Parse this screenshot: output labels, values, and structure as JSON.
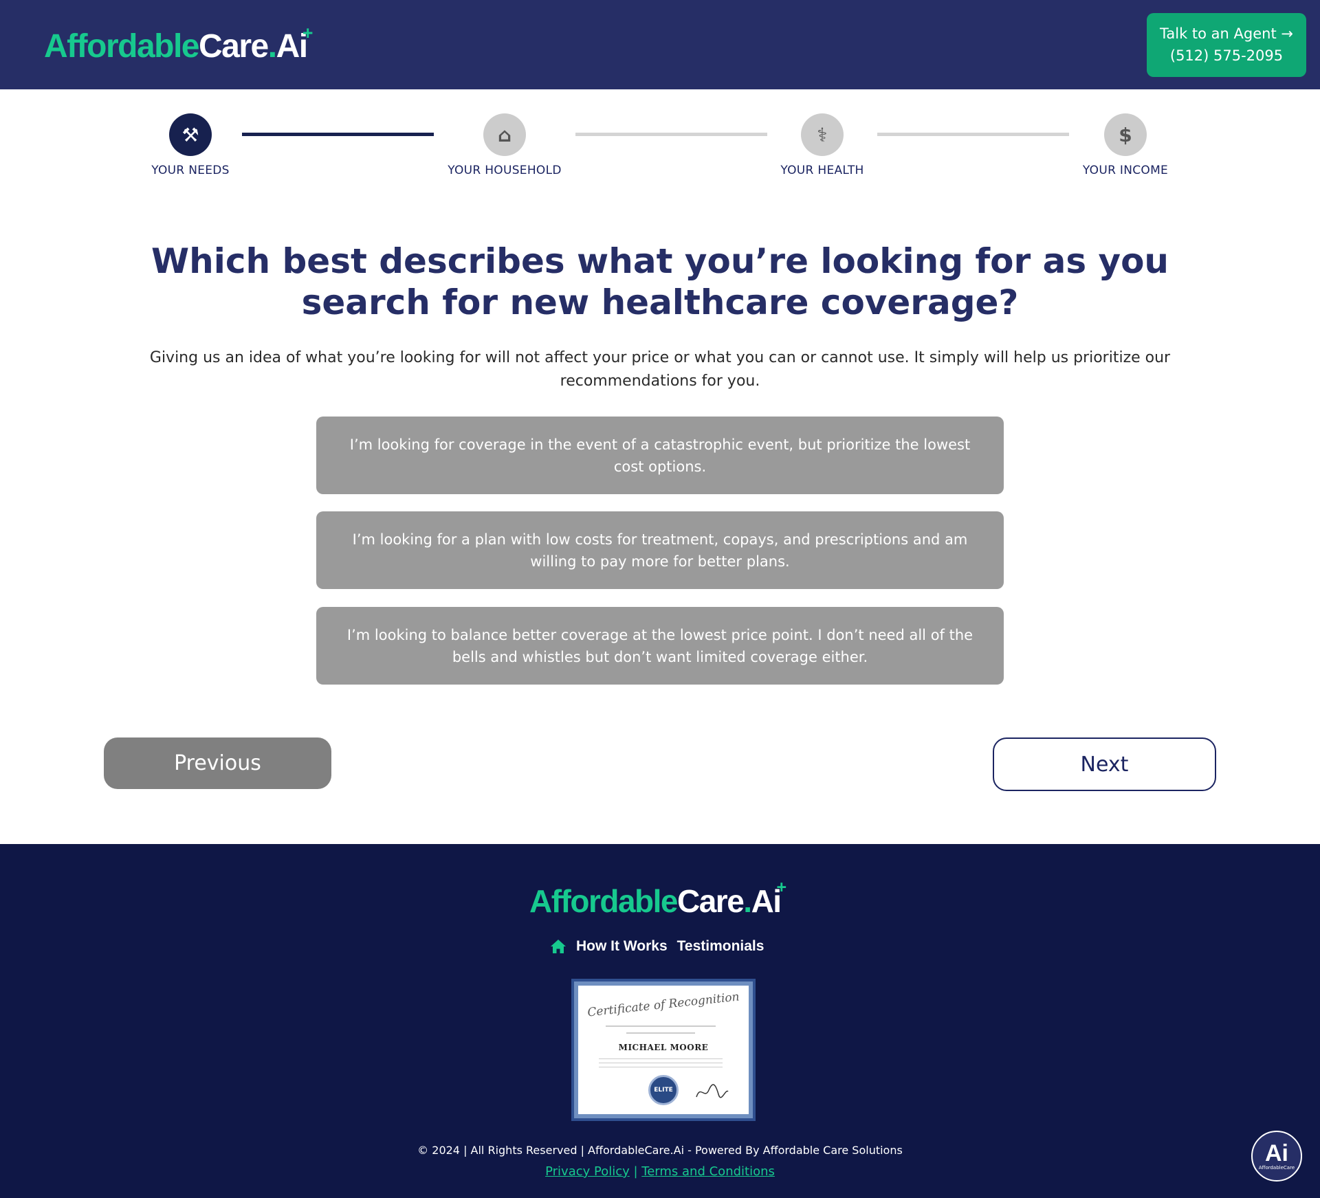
{
  "header": {
    "logo": {
      "part1": "Affordable",
      "part2": "Care",
      "dot": ".",
      "part3": "Ai",
      "plus": "+"
    },
    "agent_button": {
      "line1": "Talk to an Agent →",
      "line2": "(512) 575-2095"
    }
  },
  "stepper": {
    "steps": [
      {
        "label": "YOUR NEEDS",
        "icon": "hammer-icon",
        "glyph": "⚒",
        "state": "active"
      },
      {
        "label": "YOUR HOUSEHOLD",
        "icon": "home-icon",
        "glyph": "⌂",
        "state": "inactive"
      },
      {
        "label": "YOUR HEALTH",
        "icon": "stethoscope-icon",
        "glyph": "⚕",
        "state": "inactive"
      },
      {
        "label": "YOUR INCOME",
        "icon": "dollar-icon",
        "glyph": "$",
        "state": "inactive"
      }
    ],
    "completed_segments": 1
  },
  "question": {
    "title": "Which best describes what you’re looking for as you search for new healthcare coverage?",
    "subtext": "Giving us an idea of what you’re looking for will not affect your price or what you can or cannot use. It simply will help us prioritize our recommendations for you."
  },
  "options": [
    "I’m looking for coverage in the event of a catastrophic event, but prioritize the lowest cost options.",
    "I’m looking for a plan with low costs for treatment, copays, and prescriptions and am willing to pay more for better plans.",
    "I’m looking to balance better coverage at the lowest price point. I don’t need all of the bells and whistles but don’t want limited coverage either."
  ],
  "navigation": {
    "previous": "Previous",
    "next": "Next"
  },
  "footer": {
    "logo": {
      "part1": "Affordable",
      "part2": "Care",
      "dot": ".",
      "part3": "Ai",
      "plus": "+"
    },
    "nav": {
      "how_it_works": "How It Works",
      "testimonials": "Testimonials"
    },
    "certificate": {
      "title": "Certificate of Recognition",
      "name": "MICHAEL MOORE",
      "seal": "ELITE"
    },
    "copyright": "© 2024 | All Rights Reserved | AffordableCare.Ai - Powered By Affordable Care Solutions",
    "privacy": "Privacy Policy",
    "separator": " | ",
    "terms": "Terms and Conditions"
  },
  "ai_badge": {
    "big": "Ai",
    "small": "AffordableCare"
  },
  "colors": {
    "header_bg": "#262e66",
    "footer_bg": "#0f1746",
    "brand_green": "#17c98e",
    "agent_button": "#0fa774",
    "option_bg": "#9a9a9a",
    "step_active": "#17214f",
    "step_inactive": "#cccccc"
  }
}
